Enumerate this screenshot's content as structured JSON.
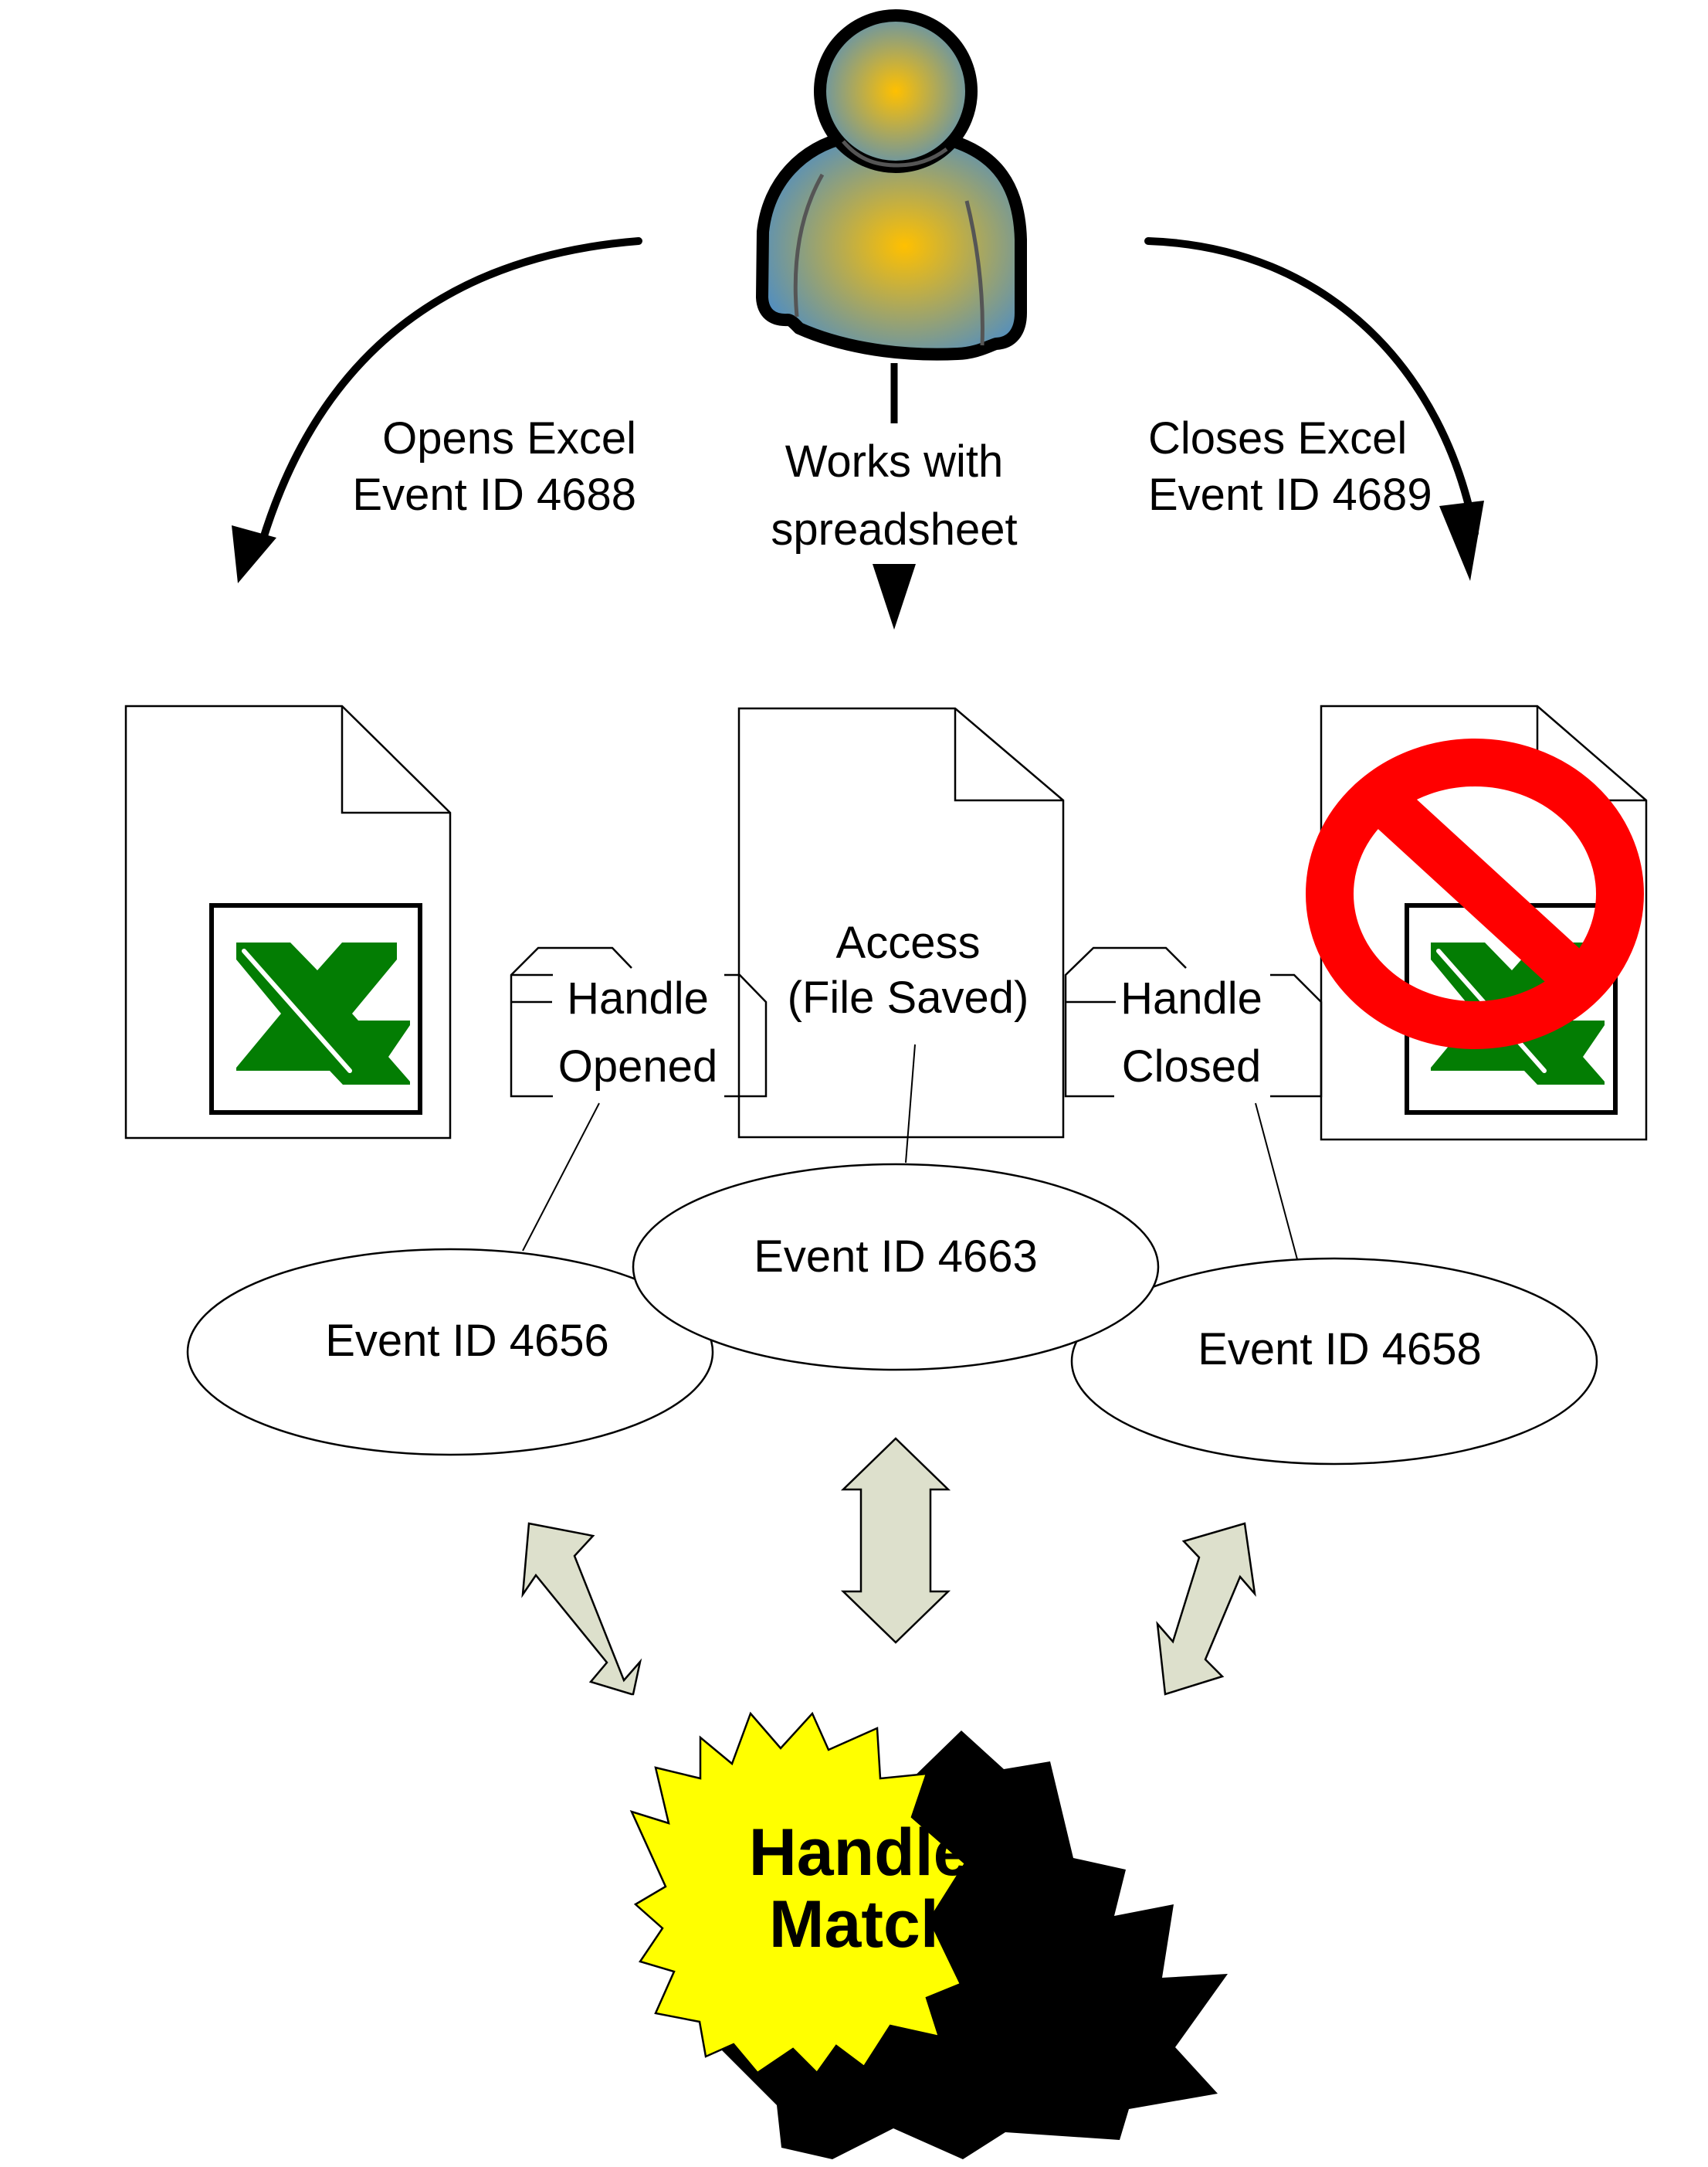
{
  "diagram": {
    "actor": {
      "name": "user",
      "icon": "user-icon"
    },
    "flows": {
      "open": {
        "line1": "Opens Excel",
        "line2": "Event ID 4688"
      },
      "work": {
        "line1": "Works with",
        "line2": "spreadsheet"
      },
      "close": {
        "line1": "Closes Excel",
        "line2": "Event ID 4689"
      }
    },
    "documents": {
      "opened": {
        "icon": "excel-icon"
      },
      "accessed": {
        "line1": "Access",
        "line2": "(File Saved)"
      },
      "closed": {
        "icon": "excel-icon",
        "overlay": "prohibited-icon"
      }
    },
    "callouts": {
      "opened": {
        "line1": "Handle",
        "line2": "Opened"
      },
      "closed": {
        "line1": "Handle",
        "line2": "Closed"
      }
    },
    "events": {
      "handle_open": "Event ID 4656",
      "access": "Event ID 4663",
      "handle_close": "Event ID 4658"
    },
    "result": {
      "line1": "Handle ID",
      "line2": "Matches"
    },
    "colors": {
      "excel_green": "#037D03",
      "prohibit_red": "#FF0000",
      "burst_yellow": "#FFFF00",
      "arrow_fill": "#DDE0CC",
      "user_blue": "#4A8CC8",
      "user_gold": "#FFC000"
    }
  }
}
